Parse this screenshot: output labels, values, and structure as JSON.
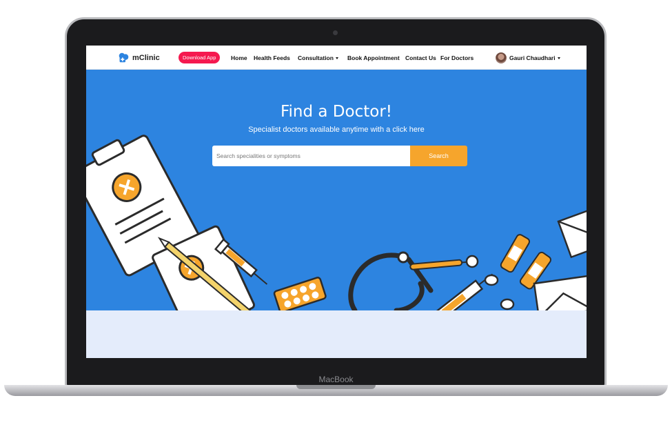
{
  "device": {
    "label": "MacBook"
  },
  "navbar": {
    "brand": "mClinic",
    "download_label": "Download App",
    "items": [
      {
        "label": "Home"
      },
      {
        "label": "Health Feeds"
      },
      {
        "label": "Consultation"
      },
      {
        "label": "Book Appointment"
      },
      {
        "label": "Contact Us"
      },
      {
        "label": "For Doctors"
      }
    ],
    "user_name": "Gauri Chaudhari"
  },
  "hero": {
    "title": "Find a Doctor!",
    "subtitle": "Specialist doctors available anytime with a click here",
    "search_placeholder": "Search specialities or symptoms",
    "search_button": "Search"
  },
  "colors": {
    "hero_bg": "#2d84e0",
    "accent": "#f6a52c",
    "download_bg": "#f5194f",
    "below_bg": "#e4ecfb"
  }
}
